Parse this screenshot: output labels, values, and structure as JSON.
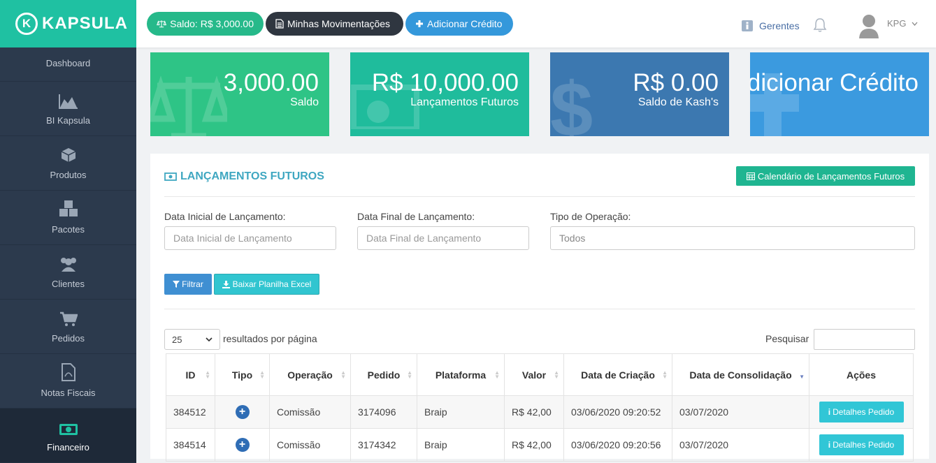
{
  "brand": {
    "name": "KAPSULA",
    "mark": "K"
  },
  "sidebar": {
    "items": [
      {
        "label": "Dashboard",
        "icon": "dashboard-icon"
      },
      {
        "label": "BI Kapsula",
        "icon": "area-chart-icon"
      },
      {
        "label": "Produtos",
        "icon": "cube-icon"
      },
      {
        "label": "Pacotes",
        "icon": "cubes-icon"
      },
      {
        "label": "Clientes",
        "icon": "users-icon"
      },
      {
        "label": "Pedidos",
        "icon": "cart-icon"
      },
      {
        "label": "Notas Fiscais",
        "icon": "file-pdf-icon"
      },
      {
        "label": "Financeiro",
        "icon": "money-icon",
        "active": true
      }
    ]
  },
  "topbar": {
    "saldo": "Saldo: R$ 3,000.00",
    "movimentacoes": "Minhas Movimentações",
    "adicionar": "Adicionar Crédito",
    "gerentes": "Gerentes",
    "user": "KPG"
  },
  "cards": [
    {
      "value": "3,000.00",
      "label": "Saldo",
      "color": "#2ec486"
    },
    {
      "value": "R$ 10,000.00",
      "label": "Lançamentos Futuros",
      "color": "#1fbc9c"
    },
    {
      "value": "R$ 0.00",
      "label": "Saldo de Kash's",
      "color": "#3c78b0"
    },
    {
      "value": "Adicionar Crédito",
      "label": "",
      "color": "#3b9adf"
    }
  ],
  "panel": {
    "title": "LANÇAMENTOS FUTUROS",
    "calendar_button": "Calendário de Lançamentos Futuros",
    "filters": {
      "inicial_label": "Data Inicial de Lançamento:",
      "inicial_placeholder": "Data Inicial de Lançamento",
      "final_label": "Data Final de Lançamento:",
      "final_placeholder": "Data Final de Lançamento",
      "tipo_label": "Tipo de Operação:",
      "tipo_value": "Todos"
    },
    "filtrar": "Filtrar",
    "baixar": "Baixar Planilha Excel",
    "per_page": "25",
    "per_page_label": "resultados por página",
    "search_label": "Pesquisar"
  },
  "table": {
    "headers": [
      "ID",
      "Tipo",
      "Operação",
      "Pedido",
      "Plataforma",
      "Valor",
      "Data de Criação",
      "Data de Consolidação",
      "Ações"
    ],
    "rows": [
      {
        "id": "384512",
        "tipo": "+",
        "operacao": "Comissão",
        "pedido": "3174096",
        "plataforma": "Braip",
        "valor": "R$ 42,00",
        "criacao": "03/06/2020 09:20:52",
        "consolidacao": "03/07/2020",
        "acao": "Detalhes Pedido"
      },
      {
        "id": "384514",
        "tipo": "+",
        "operacao": "Comissão",
        "pedido": "3174342",
        "plataforma": "Braip",
        "valor": "R$ 42,00",
        "criacao": "03/06/2020 09:20:56",
        "consolidacao": "03/07/2020",
        "acao": "Detalhes Pedido"
      }
    ]
  }
}
